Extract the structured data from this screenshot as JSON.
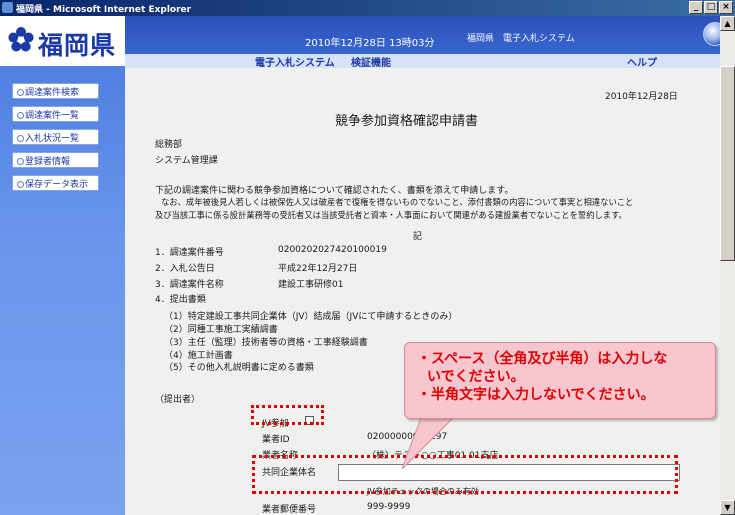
{
  "window": {
    "title": "福岡県 - Microsoft Internet Explorer",
    "buttons": [
      "_",
      "□",
      "×"
    ]
  },
  "header": {
    "logo_text": "福岡県",
    "datetime": "2010年12月28日 13時03分",
    "system_name": "福岡県　電子入札システム"
  },
  "menubar": {
    "items": [
      "電子入札システム",
      "検証機能",
      "ヘルプ"
    ]
  },
  "sidebar": {
    "items": [
      "調達案件検索",
      "調達案件一覧",
      "入札状況一覧",
      "登録者情報",
      "保存データ表示"
    ]
  },
  "document": {
    "date": "2010年12月28日",
    "title": "競争参加資格確認申請書",
    "to_dept": "総務部",
    "to_section": "システム管理課",
    "body_line1": "下記の調達案件に関わる競争参加資格について確認されたく、書類を添えて申請します。",
    "body_line2": "なお、成年被後見人若しくは被保佐人又は破産者で復権を得ないものでないこと、添付書類の内容について事実と相違ないこと",
    "body_line3": "及び当該工事に係る設計業務等の受託者又は当該受託者と資本・人事面において関連がある建設業者でないことを誓約します。",
    "ki": "記",
    "items": [
      {
        "label": "1．調達案件番号",
        "value": "0200202027420100019"
      },
      {
        "label": "2．入札公告日",
        "value": "平成22年12月27日"
      },
      {
        "label": "3．調達案件名称",
        "value": "建設工事研修01"
      },
      {
        "label": "4．提出書類",
        "value": ""
      }
    ],
    "docs": [
      "（1）特定建設工事共同企業体（JV）結成届（JVにて申請するときのみ）",
      "（2）同種工事施工実績調書",
      "（3）主任（監理）技術者等の資格・工事経験調書",
      "（4）施工計画書",
      "（5）その他入札説明書に定める書類"
    ],
    "submitter": "（提出者）",
    "jv_label": "JV参加",
    "company_id_label": "業者ID",
    "company_id_value": "02000000000197",
    "company_name_label": "業者名称",
    "company_name_value": "（株）テスト○○工事01 01支店",
    "jv_name_label": "共同企業体名",
    "jv_name_value": "",
    "jv_note": "JV参加チェックの場合のみ有効",
    "postal_label": "業者郵便番号",
    "postal_value": "999-9999"
  },
  "callout": {
    "line1": "・スペース（全角及び半角）は入力しな",
    "line2": "いでください。",
    "line3": "・半角文字は入力しないでください。"
  },
  "colors": {
    "header_blue": "#2b50b8",
    "annotation_red": "#e00000",
    "callout_pink": "#f7c6cf"
  }
}
